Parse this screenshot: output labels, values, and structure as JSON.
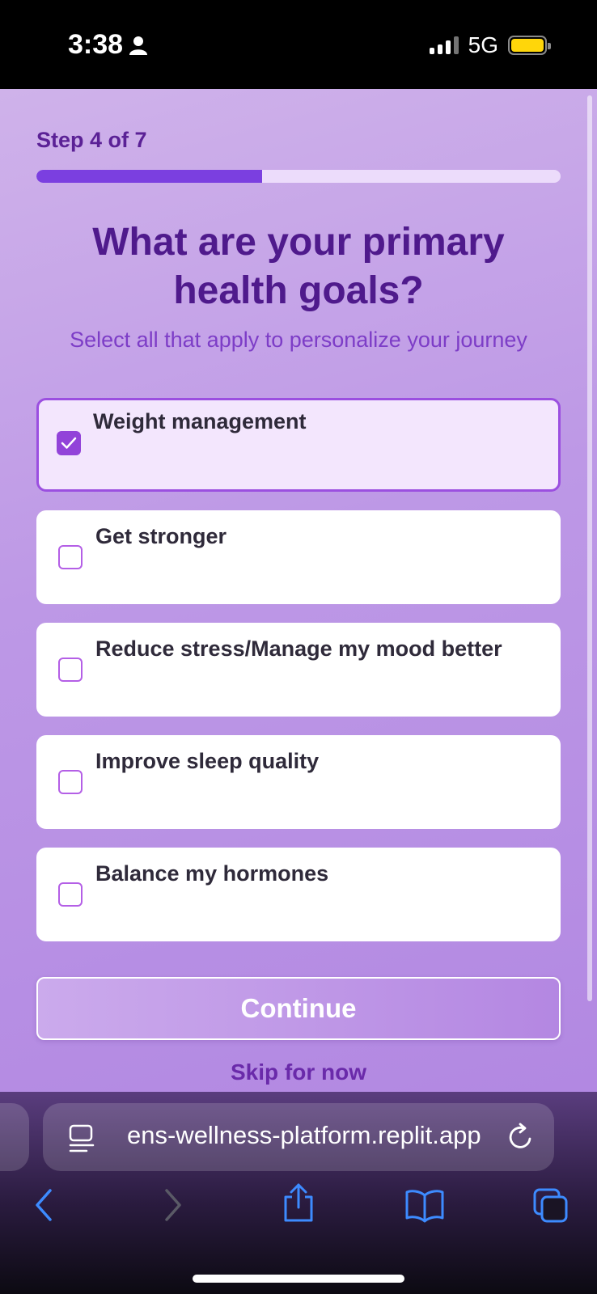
{
  "status_bar": {
    "time": "3:38",
    "network": "5G"
  },
  "onboarding": {
    "step_label": "Step 4 of 7",
    "progress": 0.43,
    "title": "What are your primary health goals?",
    "subtitle": "Select all that apply to personalize your journey",
    "options": [
      {
        "label": "Weight management",
        "checked": true
      },
      {
        "label": "Get stronger",
        "checked": false
      },
      {
        "label": "Reduce stress/Manage my mood better",
        "checked": false
      },
      {
        "label": "Improve sleep quality",
        "checked": false
      },
      {
        "label": "Balance my hormones",
        "checked": false
      }
    ],
    "continue_label": "Continue",
    "skip_label": "Skip for now"
  },
  "browser": {
    "url": "ens-wellness-platform.replit.app"
  },
  "colors": {
    "accent": "#7b3fe0",
    "title": "#4f1a8c",
    "checkbox": "#9243d9",
    "toolbar_icon": "#3d8bff"
  }
}
